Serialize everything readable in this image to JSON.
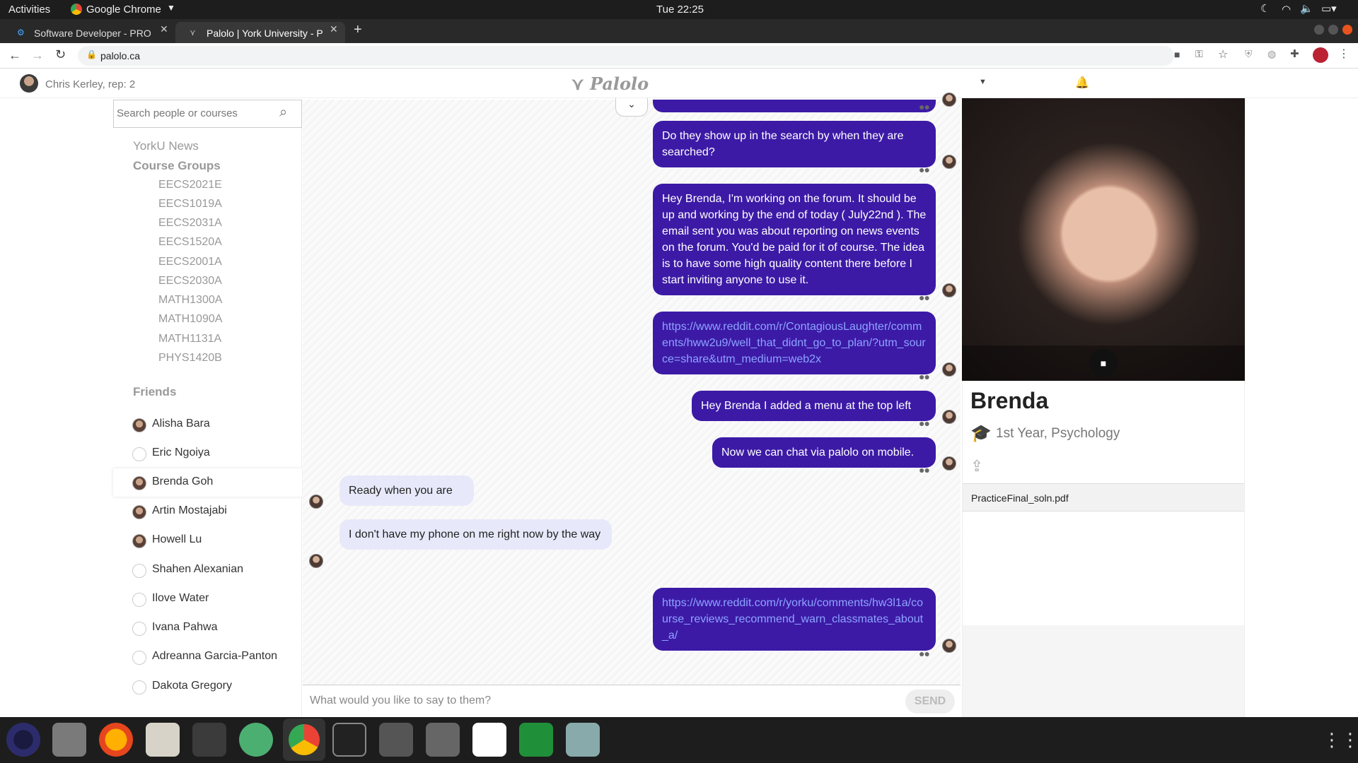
{
  "system": {
    "activities": "Activities",
    "app": "Google Chrome",
    "clock": "Tue 22:25"
  },
  "browser": {
    "tabs": [
      {
        "title": "Software Developer - PRO"
      },
      {
        "title": "Palolo | York University - P"
      }
    ],
    "url": "palolo.ca"
  },
  "app_header": {
    "user": "Chris Kerley, rep: 2",
    "logo": "Palolo"
  },
  "sidebar": {
    "search_placeholder": "Search people or courses",
    "news": "YorkU News",
    "groups_title": "Course Groups",
    "groups": [
      "EECS2021E",
      "EECS1019A",
      "EECS2031A",
      "EECS1520A",
      "EECS2001A",
      "EECS2030A",
      "MATH1300A",
      "MATH1090A",
      "MATH1131A",
      "PHYS1420B"
    ],
    "friends_title": "Friends",
    "friends": [
      "Alisha Bara",
      "Eric Ngoiya",
      "Brenda Goh",
      "Artin Mostajabi",
      "Howell Lu",
      "Shahen Alexanian",
      "Ilove Water",
      "Ivana Pahwa",
      "Adreanna Garcia-Panton",
      "Dakota Gregory"
    ]
  },
  "chat": {
    "messages": [
      {
        "from": "me",
        "text": "Do they show up in the search by when they are searched?"
      },
      {
        "from": "me",
        "text": "Hey Brenda, I'm working on the forum. It should be up and working by the end of today ( July22nd ). The email sent you was about reporting on news events on the forum. You'd be paid for it of course. The idea is to have some high quality content there before I start inviting anyone to use it."
      },
      {
        "from": "me",
        "text": "https://www.reddit.com/r/ContagiousLaughter/comments/hww2u9/well_that_didnt_go_to_plan/?utm_source=share&utm_medium=web2x"
      },
      {
        "from": "me",
        "text": "Hey Brenda I added a menu at the top left"
      },
      {
        "from": "me",
        "text": "Now we can chat via palolo on mobile."
      },
      {
        "from": "them",
        "text": "Ready when you are"
      },
      {
        "from": "them",
        "text": "I don't have my phone on me right now by the way"
      },
      {
        "from": "me",
        "text": "https://www.reddit.com/r/yorku/comments/hw3l1a/course_reviews_recommend_warn_classmates_about_a/"
      }
    ],
    "input_placeholder": "What would you like to say to them?",
    "send_label": "SEND"
  },
  "profile": {
    "name": "Brenda",
    "info": "1st Year, Psychology",
    "file": "PracticeFinal_soln.pdf"
  },
  "colors": {
    "bubble_out": "#3c1aa6",
    "bubble_in": "#e7e9fa",
    "link": "#8ea3ff"
  }
}
